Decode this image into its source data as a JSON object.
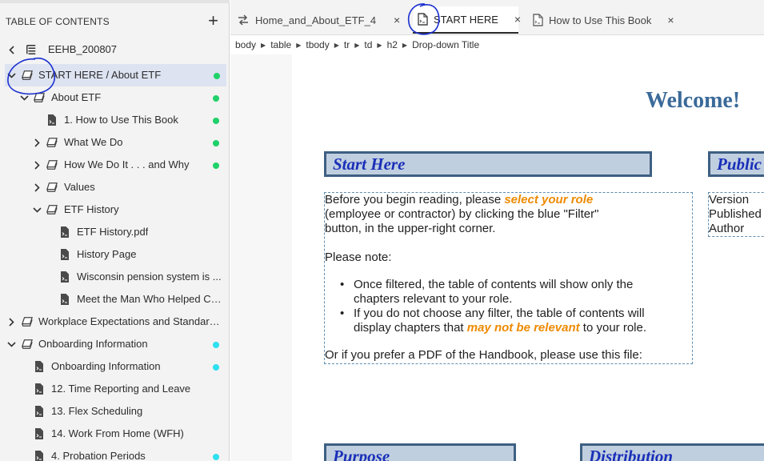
{
  "sidebar": {
    "title": "TABLE OF CONTENTS",
    "add_symbol": "+",
    "items": [
      {
        "label": "EEHB_200807",
        "icon": "table-of-contents-icon",
        "chevron": "back",
        "dot": null
      },
      {
        "label": "START HERE / About ETF",
        "icon": "book-icon",
        "chevron": "expanded",
        "dot": "#1fd16a",
        "selected": true
      },
      {
        "label": "About ETF",
        "icon": "book-icon",
        "chevron": "expanded",
        "dot": "#1fd16a"
      },
      {
        "label": "1. How to Use This Book",
        "icon": "page-icon",
        "chevron": null,
        "dot": "#1fd16a"
      },
      {
        "label": "What We Do",
        "icon": "book-icon",
        "chevron": "collapsed",
        "dot": "#1fd16a"
      },
      {
        "label": "How We Do It . . . and Why",
        "icon": "book-icon",
        "chevron": "collapsed",
        "dot": "#1fd16a"
      },
      {
        "label": "Values",
        "icon": "book-icon",
        "chevron": "collapsed",
        "dot": null
      },
      {
        "label": "ETF History",
        "icon": "book-icon",
        "chevron": "expanded",
        "dot": null
      },
      {
        "label": "ETF History.pdf",
        "icon": "page-icon",
        "chevron": null,
        "dot": null
      },
      {
        "label": "History Page",
        "icon": "page-icon",
        "chevron": null,
        "dot": null
      },
      {
        "label": "Wisconsin pension system is ...",
        "icon": "page-icon",
        "chevron": null,
        "dot": null
      },
      {
        "label": "Meet the Man Who Helped Cr...",
        "icon": "page-icon",
        "chevron": null,
        "dot": null
      },
      {
        "label": "Workplace Expectations and Standard...",
        "icon": "book-icon",
        "chevron": "collapsed",
        "dot": null
      },
      {
        "label": "Onboarding Information",
        "icon": "book-icon",
        "chevron": "expanded",
        "dot": "#2ee0ef"
      },
      {
        "label": "Onboarding Information",
        "icon": "page-icon",
        "chevron": null,
        "dot": "#2ee0ef"
      },
      {
        "label": "12. Time Reporting and Leave",
        "icon": "page-icon",
        "chevron": null,
        "dot": null
      },
      {
        "label": "13. Flex Scheduling",
        "icon": "page-icon",
        "chevron": null,
        "dot": null
      },
      {
        "label": "14. Work From Home (WFH)",
        "icon": "page-icon",
        "chevron": null,
        "dot": null
      },
      {
        "label": "4. Probation Periods",
        "icon": "page-icon",
        "chevron": null,
        "dot": "#2ee0ef"
      }
    ]
  },
  "tabs": [
    {
      "label": "Home_and_About_ETF_4",
      "icon": "swap-arrows-icon",
      "close": "×"
    },
    {
      "label": "START HERE",
      "icon": "page-icon",
      "close": "×",
      "active": true
    },
    {
      "label": "How to Use This Book",
      "icon": "page-icon",
      "close": "×"
    }
  ],
  "breadcrumb": [
    "body",
    "table",
    "tbody",
    "tr",
    "td",
    "h2",
    "Drop-down Title"
  ],
  "document": {
    "welcome": "Welcome!",
    "start_here_heading": "Start Here",
    "publication_heading": "Public",
    "intro_1": "Before you begin reading, please ",
    "intro_highlight": "select your role",
    "intro_2": "(employee or contractor) by clicking the blue \"Filter\"",
    "intro_3": "button, in the upper-right corner.",
    "note": "Please note:",
    "bullet_1a": "Once filtered, the table of contents will show only the",
    "bullet_1b": "chapters relevant to your role.",
    "bullet_2a": "If you do not choose any filter, the table of contents will",
    "bullet_2b_pre": "display chapters that ",
    "bullet_2b_hl": "may not be relevant",
    "bullet_2b_post": " to your role.",
    "pdf_line": "Or if you prefer a PDF of the Handbook, please use this file:",
    "info_version": "Version",
    "info_published": "Published",
    "info_author": "Author",
    "purpose_heading": "Purpose",
    "distribution_heading": "Distribution"
  },
  "colors": {
    "accent_heading": "#1a2fb8",
    "heading_box_fill": "#c0cfe0",
    "welcome": "#3b6a99",
    "highlight": "#ee8a00",
    "annotation_ink": "#1a2fd0"
  }
}
